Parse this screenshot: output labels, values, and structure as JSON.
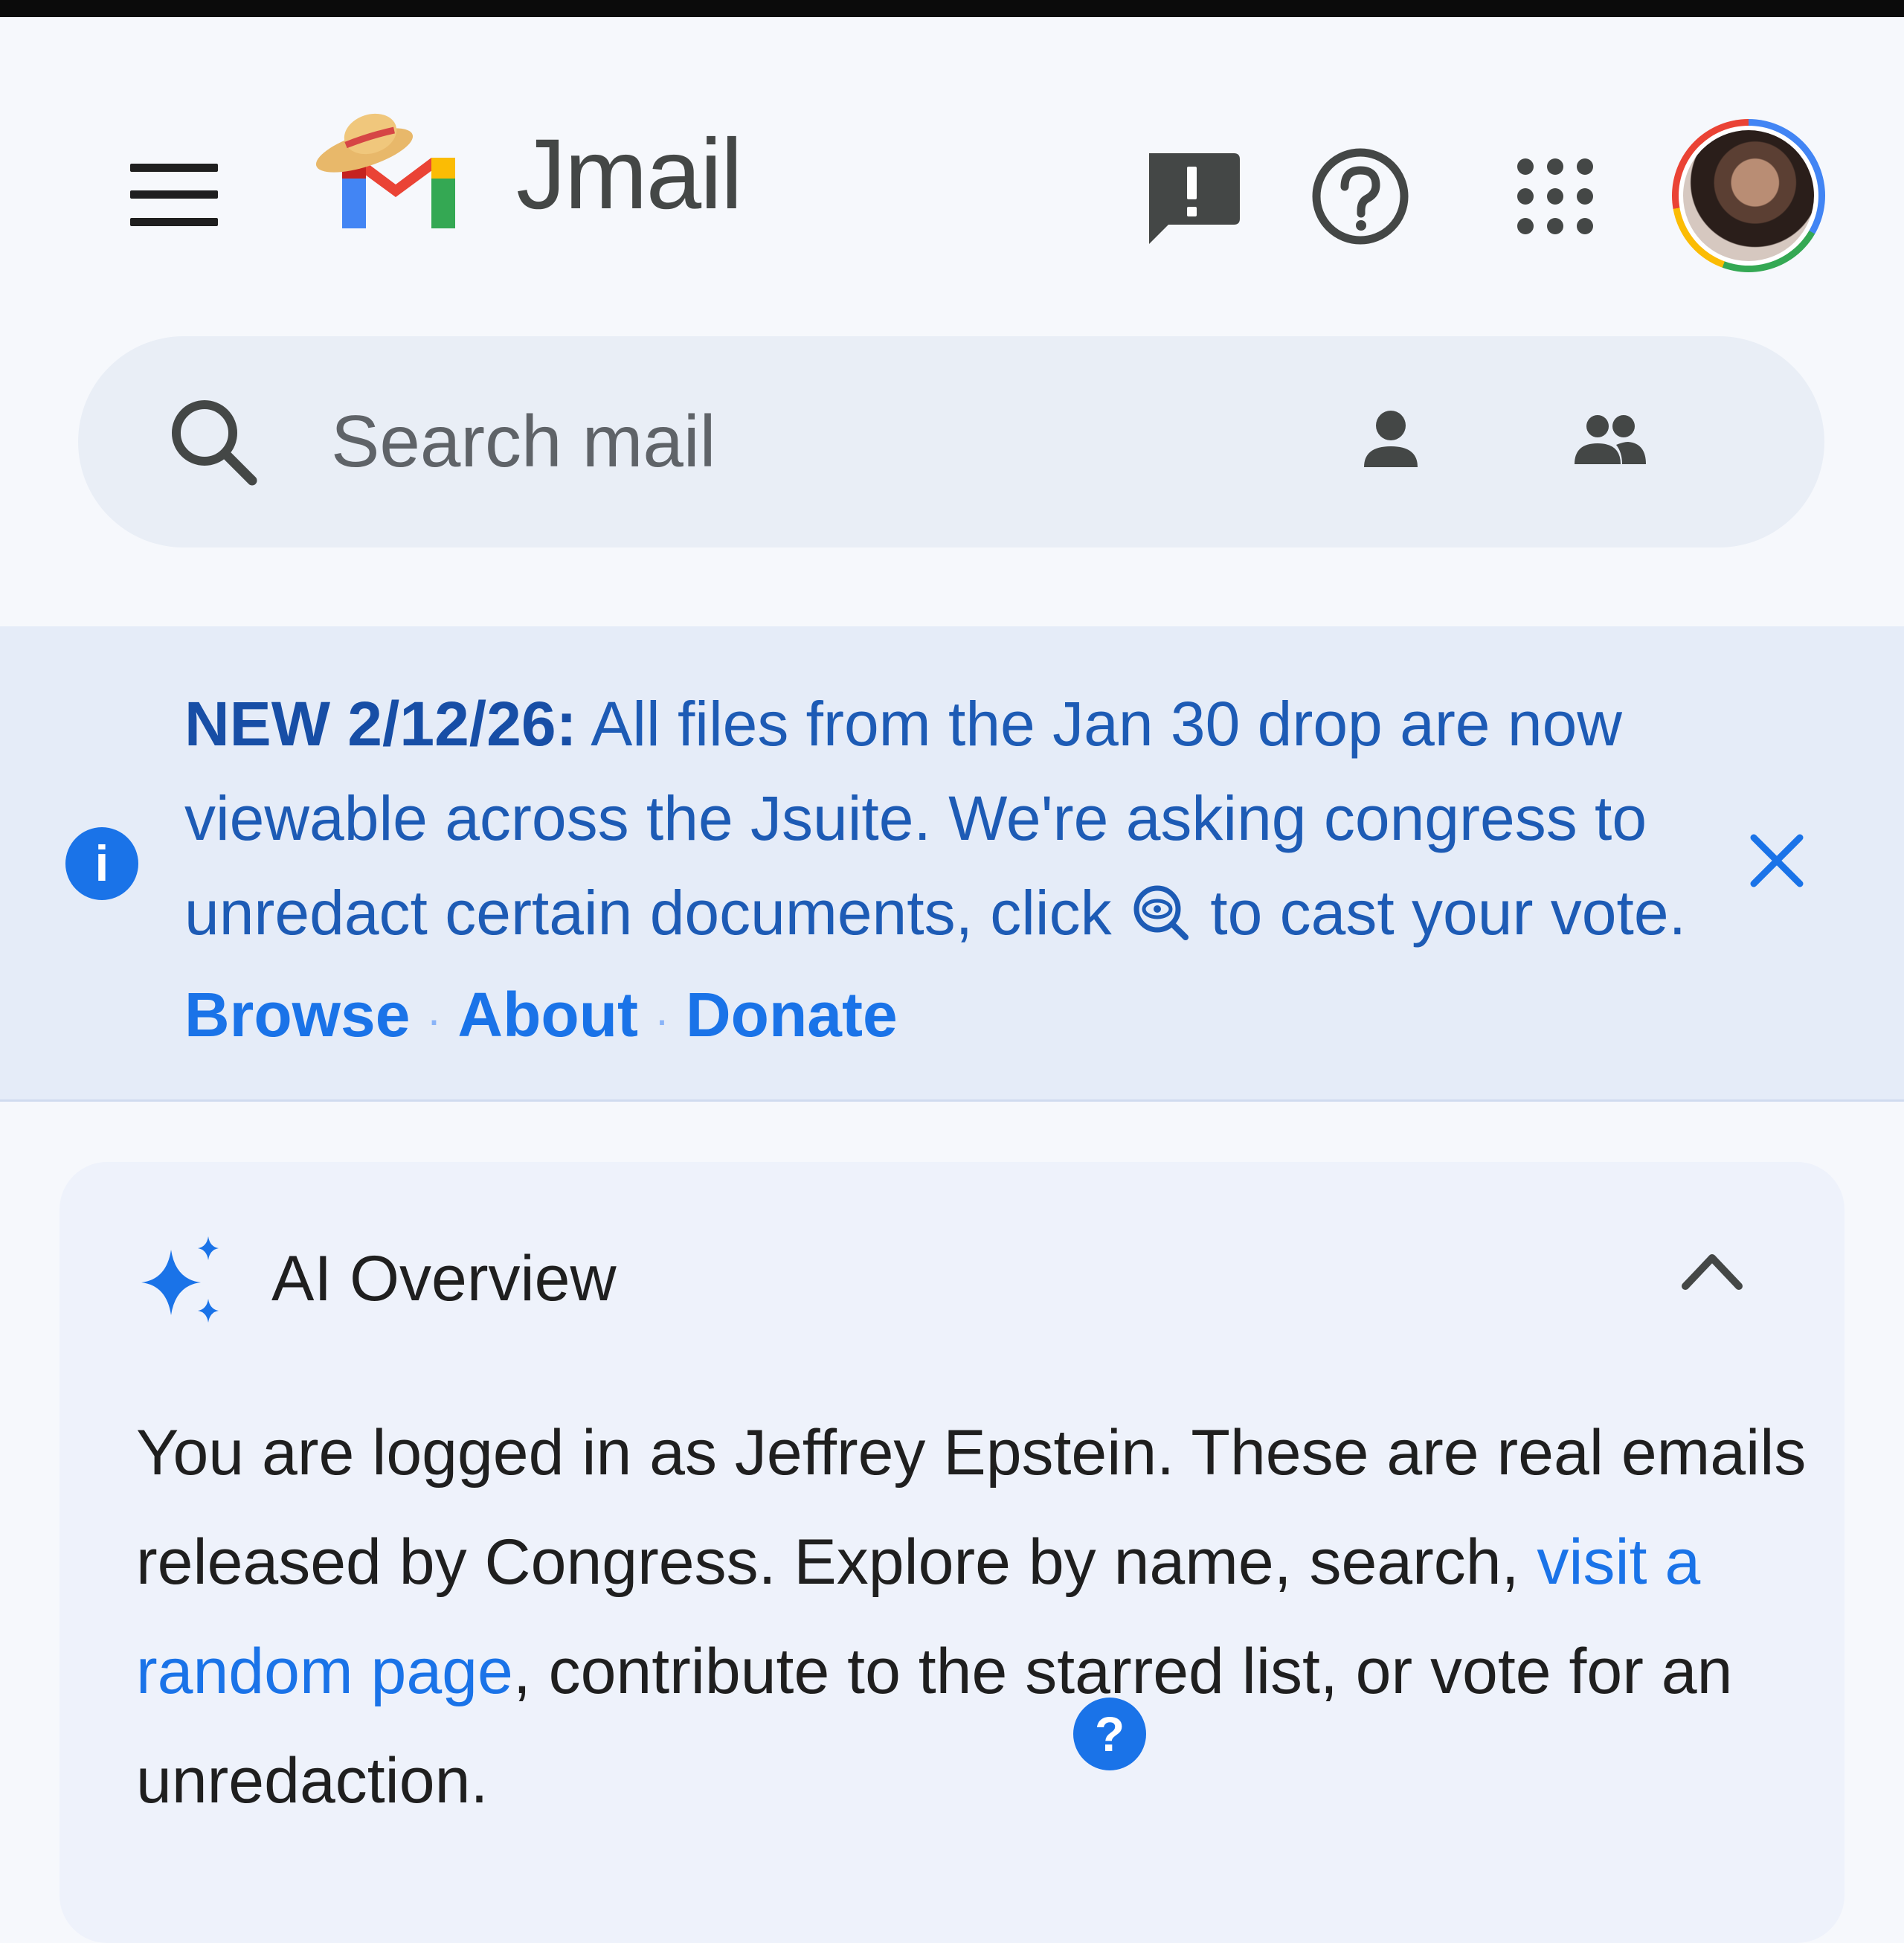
{
  "app": {
    "title": "Jmail"
  },
  "header": {
    "menu_icon": "hamburger-menu-icon",
    "feedback_icon": "feedback-icon",
    "help_icon": "help-circle-icon",
    "apps_icon": "apps-grid-icon",
    "avatar_alt": "Account avatar"
  },
  "search": {
    "placeholder": "Search mail",
    "person_icon": "person-icon",
    "people_icon": "people-icon"
  },
  "banner": {
    "prefix": "NEW 2/12/26:",
    "text_before_icon": " All files from the Jan 30 drop are now viewable across the Jsuite. We're asking congress to unredact certain documents, click ",
    "text_after_icon": " to cast your vote. ",
    "links": {
      "browse": "Browse",
      "about": "About",
      "donate": "Donate"
    },
    "separator": "·",
    "colors": {
      "background": "#e5ecf8",
      "text": "#1d5bb5",
      "link": "#1a73e8"
    }
  },
  "ai_overview": {
    "title": "AI Overview",
    "body_before_link": "You are logged in as Jeffrey Epstein. These are real emails released by Congress. Explore by name, search, ",
    "link_text": "visit a random page",
    "body_after_link": ", contribute to the starred list, or vote for an unredaction.",
    "help_badge": "?"
  },
  "colors": {
    "accent": "#1a73e8",
    "page_background": "#f6f8fc",
    "search_background": "#e9eef6",
    "card_background": "#eef2fb"
  }
}
